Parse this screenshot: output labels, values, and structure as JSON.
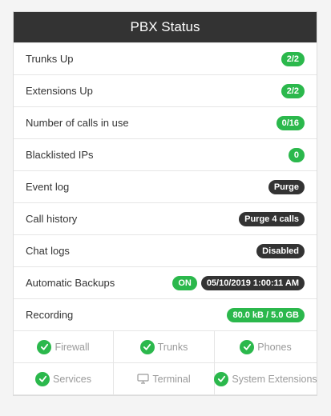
{
  "panel": {
    "title": "PBX Status"
  },
  "rows": [
    {
      "label": "Trunks Up",
      "badges": [
        {
          "text": "2/2",
          "color": "green"
        }
      ]
    },
    {
      "label": "Extensions Up",
      "badges": [
        {
          "text": "2/2",
          "color": "green"
        }
      ]
    },
    {
      "label": "Number of calls in use",
      "badges": [
        {
          "text": "0/16",
          "color": "green"
        }
      ]
    },
    {
      "label": "Blacklisted IPs",
      "badges": [
        {
          "text": "0",
          "color": "green"
        }
      ]
    },
    {
      "label": "Event log",
      "badges": [
        {
          "text": "Purge",
          "color": "dark"
        }
      ]
    },
    {
      "label": "Call history",
      "badges": [
        {
          "text": "Purge 4 calls",
          "color": "dark"
        }
      ]
    },
    {
      "label": "Chat logs",
      "badges": [
        {
          "text": "Disabled",
          "color": "dark"
        }
      ]
    },
    {
      "label": "Automatic Backups",
      "badges": [
        {
          "text": "ON",
          "color": "green"
        },
        {
          "text": "05/10/2019 1:00:11 AM",
          "color": "dark"
        }
      ]
    },
    {
      "label": "Recording",
      "badges": [
        {
          "text": "80.0 kB / 5.0 GB",
          "color": "green"
        }
      ]
    }
  ],
  "services": [
    {
      "label": "Firewall",
      "icon": "check-icon"
    },
    {
      "label": "Trunks",
      "icon": "check-icon"
    },
    {
      "label": "Phones",
      "icon": "check-icon"
    },
    {
      "label": "Services",
      "icon": "check-icon"
    },
    {
      "label": "Terminal",
      "icon": "monitor-icon"
    },
    {
      "label": "System Extensions",
      "icon": "check-icon"
    }
  ],
  "colors": {
    "green": "#2bb84c",
    "dark": "#333333",
    "header_bg": "#333333"
  }
}
